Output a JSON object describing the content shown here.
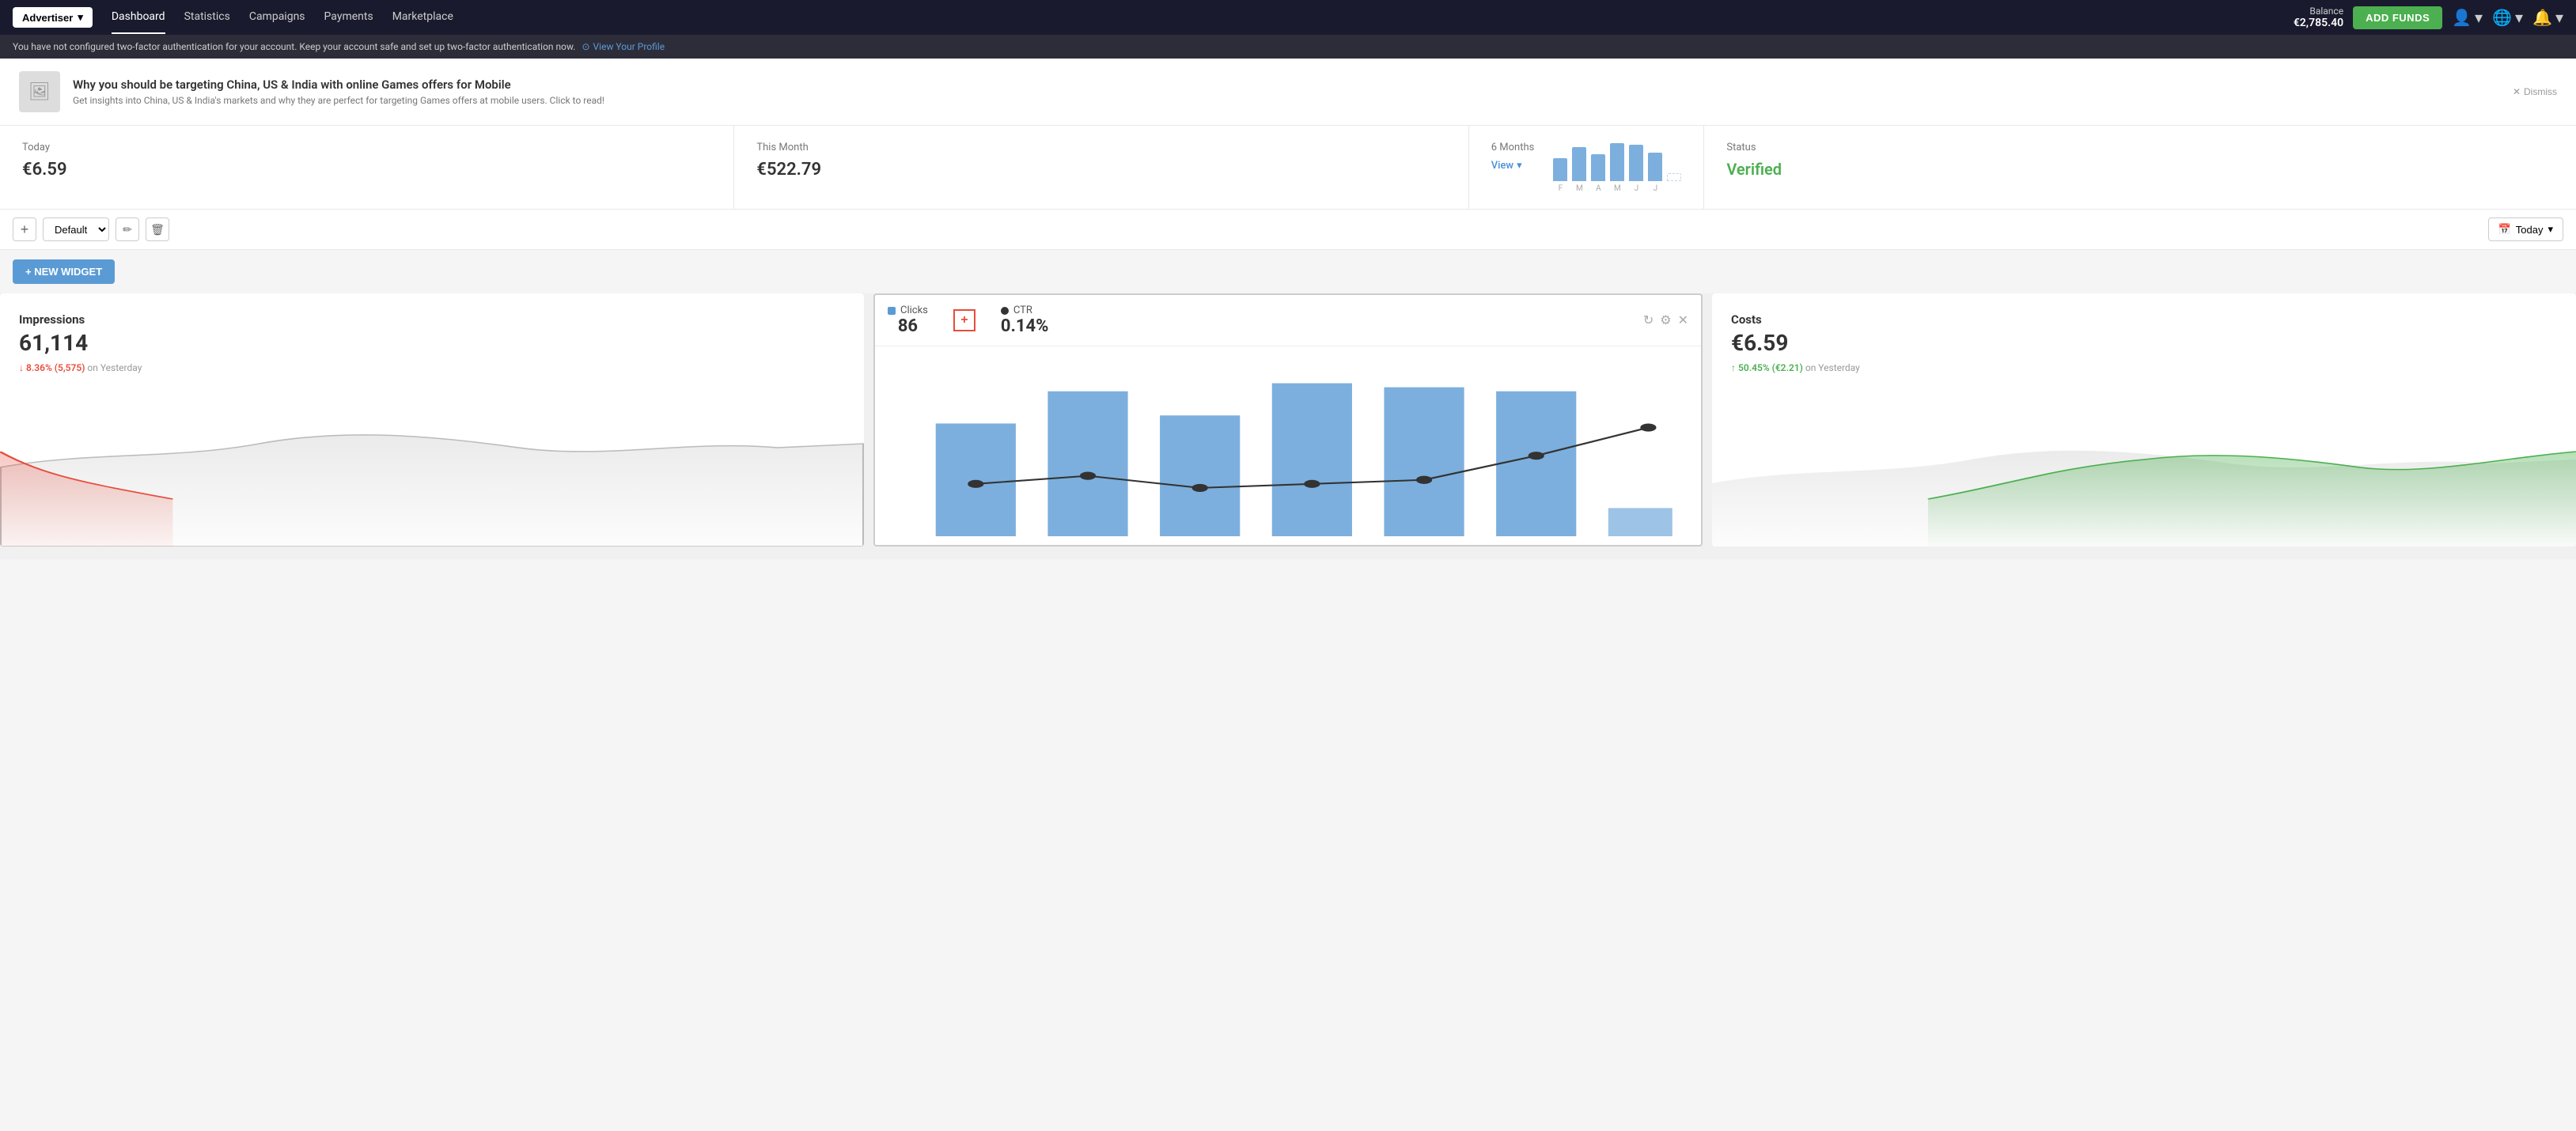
{
  "nav": {
    "advertiser_label": "Advertiser",
    "links": [
      {
        "label": "Dashboard",
        "active": true
      },
      {
        "label": "Statistics",
        "active": false
      },
      {
        "label": "Campaigns",
        "active": false
      },
      {
        "label": "Payments",
        "active": false
      },
      {
        "label": "Marketplace",
        "active": false
      }
    ],
    "balance_label": "Balance",
    "balance_amount": "€2,785.40",
    "add_funds_label": "ADD FUNDS"
  },
  "alert": {
    "message": "You have not configured two-factor authentication for your account. Keep your account safe and set up two-factor authentication now.",
    "link_label": "View Your Profile"
  },
  "promo": {
    "title": "Why you should be targeting China, US & India with online Games offers for Mobile",
    "description": "Get insights into China, US & India's markets and why they are perfect for targeting Games offers at mobile users. Click to read!",
    "dismiss_label": "Dismiss"
  },
  "stats": {
    "today": {
      "label": "Today",
      "value": "€6.59"
    },
    "this_month": {
      "label": "This Month",
      "value": "€522.79"
    },
    "six_months": {
      "label": "6 Months",
      "view_label": "View",
      "bars": [
        30,
        45,
        35,
        50,
        48,
        38,
        10
      ],
      "labels": [
        "F",
        "M",
        "A",
        "M",
        "J",
        "J"
      ]
    },
    "status": {
      "label": "Status",
      "value": "Verified"
    }
  },
  "toolbar": {
    "add_label": "+",
    "default_label": "Default",
    "edit_icon": "✏",
    "delete_icon": "🗑",
    "date_label": "Today",
    "calendar_icon": "📅"
  },
  "new_widget": {
    "label": "+ NEW WIDGET"
  },
  "widgets": {
    "impressions": {
      "title": "Impressions",
      "value": "61,114",
      "change_pct": "↓ 8.36%",
      "change_val": "(5,575)",
      "change_suffix": "on Yesterday"
    },
    "clicks": {
      "legend_label": "Clicks",
      "value": "86"
    },
    "ctr": {
      "legend_label": "CTR",
      "value": "0.14%"
    },
    "costs": {
      "title": "Costs",
      "value": "€6.59",
      "change_pct": "↑ 50.45%",
      "change_val": "(€2.21)",
      "change_suffix": "on Yesterday"
    }
  }
}
